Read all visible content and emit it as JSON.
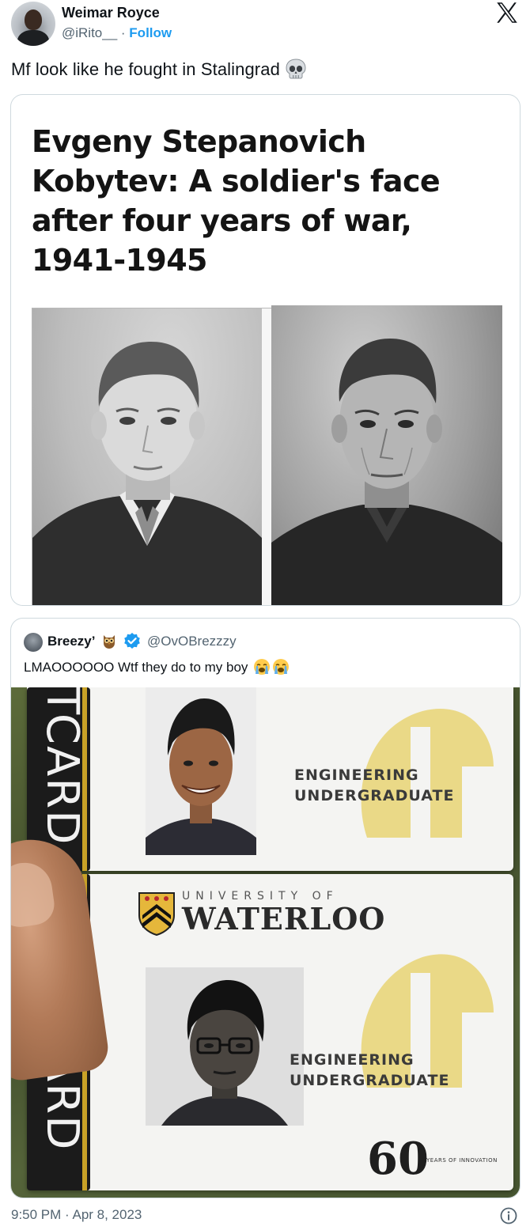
{
  "tweet": {
    "author_name": "Weimar Royce",
    "author_handle": "@iRito__",
    "separator": " · ",
    "follow_label": "Follow",
    "text": "Mf look like he fought in Stalingrad",
    "text_emoji": "skull-emoji",
    "timestamp": "9:50 PM · Apr 8, 2023"
  },
  "media": {
    "article_title": "Evgeny Stepanovich\nKobytev: A soldier's face\nafter four years of war,\n1941-1945"
  },
  "quoted_tweet": {
    "author_name": "Breezy’",
    "author_badges": [
      "owl-emoji",
      "verified-badge-icon"
    ],
    "author_handle": "@OvOBrezzzy",
    "text": "LMAOOOOOO Wtf they do to my boy",
    "text_emojis": [
      "crying-face-emoji",
      "crying-face-emoji"
    ],
    "card_top": {
      "strip_text": "TCARD",
      "program": "ENGINEERING\nUNDERGRADUATE"
    },
    "card_bottom": {
      "strip_text": "TCARD",
      "university_line1": "UNIVERSITY OF",
      "university_line2": "WATERLOO",
      "program": "ENGINEERING\nUNDERGRADUATE",
      "anniversary_number": "60",
      "anniversary_label": "YEARS OF INNOVATION"
    }
  },
  "colors": {
    "link_blue": "#1d9bf0",
    "secondary_text": "#536471",
    "border": "#cfd9de",
    "waterloo_gold": "#c9a227"
  },
  "icons": {
    "close_logo": "x-logo-icon",
    "info": "info-icon"
  }
}
